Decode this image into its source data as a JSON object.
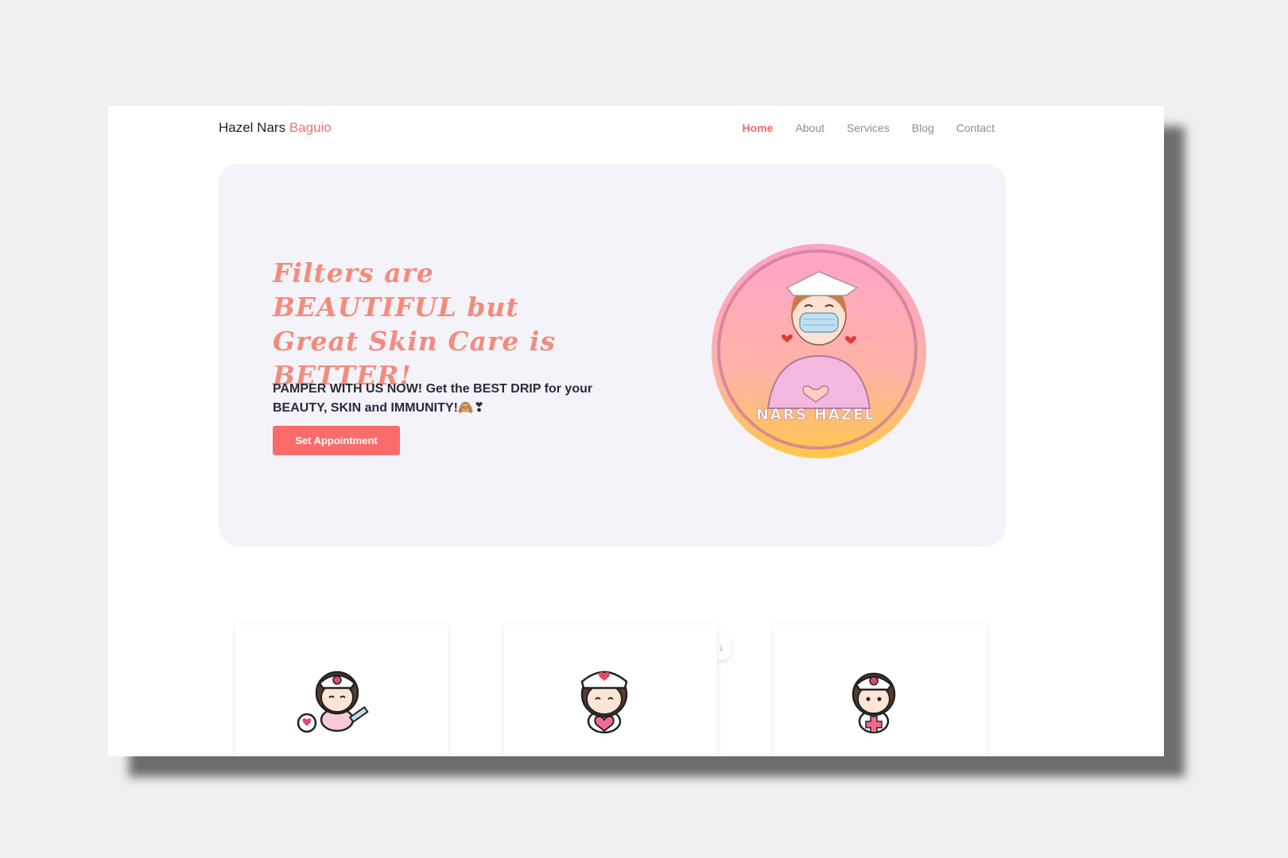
{
  "header": {
    "brand_main": "Hazel Nars",
    "brand_accent": "Baguio",
    "nav": [
      {
        "label": "Home",
        "active": true
      },
      {
        "label": "About"
      },
      {
        "label": "Services"
      },
      {
        "label": "Blog"
      },
      {
        "label": "Contact"
      }
    ]
  },
  "hero": {
    "title": "Filters are BEAUTIFUL but Great Skin Care is BETTER!",
    "subtitle": "PAMPER WITH US NOW! Get the BEST DRIP for your BEAUTY, SKIN and IMMUNITY!🙈❣",
    "cta_label": "Set Appointment",
    "logo_text": "NARS HAZEL"
  },
  "scroll": {
    "icon": "arrow-down-icon"
  },
  "cards": [
    {
      "icon": "nurse-syringe-icon"
    },
    {
      "icon": "nurse-heart-icon"
    },
    {
      "icon": "nurse-cross-icon"
    }
  ],
  "colors": {
    "accent": "#f26a6a",
    "button": "#fa6b6b",
    "hero_bg": "#f4f3f9",
    "title": "#f48b7c",
    "page_bg": "#eff0f2"
  }
}
